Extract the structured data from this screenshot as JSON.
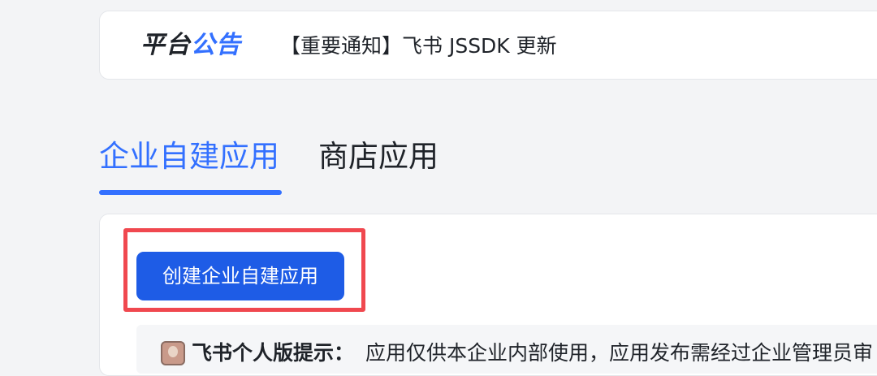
{
  "announcement": {
    "title_part1": "平台",
    "title_part2": "公告",
    "text": "【重要通知】飞书 JSSDK 更新"
  },
  "tabs": [
    {
      "label": "企业自建应用",
      "active": true
    },
    {
      "label": "商店应用",
      "active": false
    }
  ],
  "panel": {
    "create_button_label": "创建企业自建应用",
    "tip": {
      "icon": "user-avatar",
      "label": "飞书个人版提示：",
      "text": "应用仅供本企业内部使用，应用发布需经过企业管理员审"
    }
  },
  "colors": {
    "accent": "#3370ff",
    "button": "#1e5ce6",
    "highlight": "#f0484f"
  }
}
